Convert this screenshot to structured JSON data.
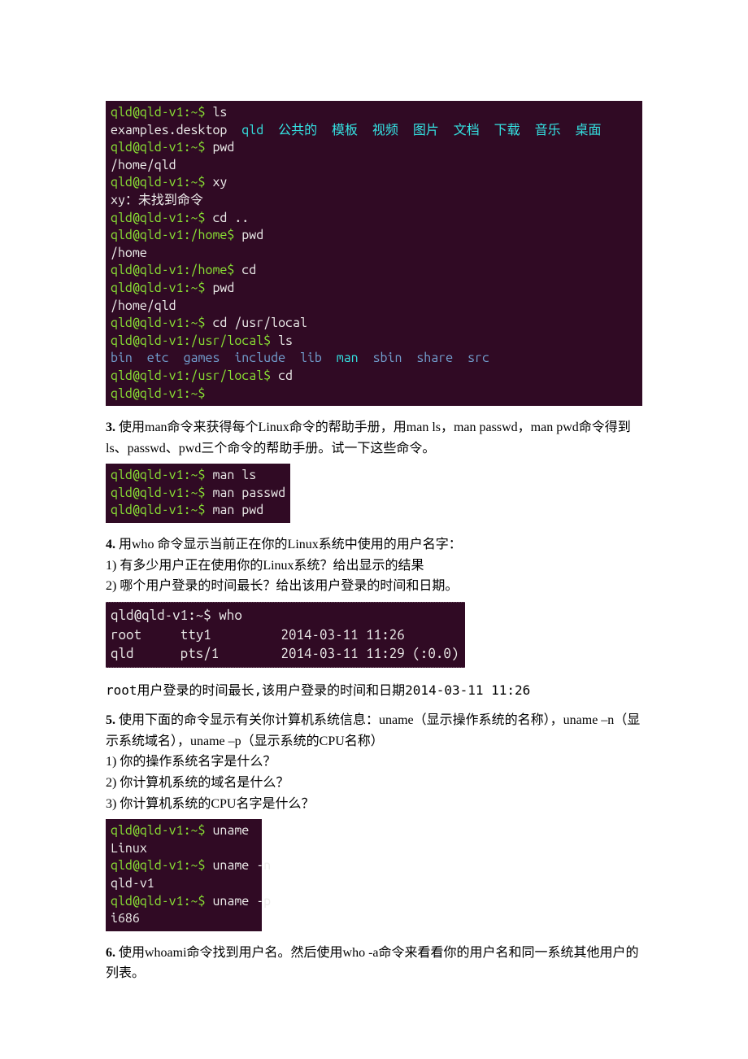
{
  "terminal1": {
    "l1_prompt": "qld@qld-v1:~$",
    "l1_cmd": " ls",
    "l2_a": "examples.desktop  ",
    "l2_b": "qld  公共的  模板  视频  图片  文档  下载  音乐  桌面",
    "l3_prompt": "qld@qld-v1:~$",
    "l3_cmd": " pwd",
    "l4": "/home/qld",
    "l5_prompt": "qld@qld-v1:~$",
    "l5_cmd": " xy",
    "l6": "xy：未找到命令",
    "l7_prompt": "qld@qld-v1:~$",
    "l7_cmd": " cd ..",
    "l8_prompt": "qld@qld-v1:/home$",
    "l8_cmd": " pwd",
    "l9": "/home",
    "l10_prompt": "qld@qld-v1:/home$",
    "l10_cmd": " cd",
    "l11_prompt": "qld@qld-v1:~$",
    "l11_cmd": " pwd",
    "l12": "/home/qld",
    "l13_prompt": "qld@qld-v1:~$",
    "l13_cmd": " cd /usr/local",
    "l14_prompt": "qld@qld-v1:/usr/local$",
    "l14_cmd": " ls",
    "l15_a": "bin  etc  games  include  lib  ",
    "l15_b": "man",
    "l15_c": "  sbin  share  ",
    "l15_d": "src",
    "l16_prompt": "qld@qld-v1:/usr/local$",
    "l16_cmd": " cd",
    "l17_prompt": "qld@qld-v1:~$",
    "l17_cmd": ""
  },
  "q3": {
    "body": "使用man命令来获得每个Linux命令的帮助手册，用man ls，man passwd，man pwd命令得到ls、passwd、pwd三个命令的帮助手册。试一下这些命令。",
    "num": "3. "
  },
  "terminal2": {
    "l1_prompt": "qld@qld-v1:~$",
    "l1_cmd": " man ls",
    "l2_prompt": "qld@qld-v1:~$",
    "l2_cmd": " man passwd",
    "l3_prompt": "qld@qld-v1:~$",
    "l3_cmd": " man pwd"
  },
  "q4": {
    "num": "4. ",
    "l1": "用who 命令显示当前正在你的Linux系统中使用的用户名字：",
    "l2": "1) 有多少用户正在使用你的Linux系统？给出显示的结果",
    "l3": "2) 哪个用户登录的时间最长？给出该用户登录的时间和日期。"
  },
  "terminal3": {
    "l1_prompt": "qld@qld-v1:~$",
    "l1_cmd": " who",
    "row1": "root     tty1         2014-03-11 11:26",
    "row2": "qld      pts/1        2014-03-11 11:29 (:0.0)"
  },
  "note4": "root用户登录的时间最长,该用户登录的时间和日期2014-03-11 11:26",
  "q5": {
    "num": "5. ",
    "l1": "使用下面的命令显示有关你计算机系统信息：uname（显示操作系统的名称），uname –n（显示系统域名），uname –p（显示系统的CPU名称）",
    "l2": "1) 你的操作系统名字是什么？",
    "l3": "2) 你计算机系统的域名是什么？",
    "l4": "3) 你计算机系统的CPU名字是什么？"
  },
  "terminal4": {
    "l1_prompt": "qld@qld-v1:~$",
    "l1_cmd": " uname",
    "l2": "Linux",
    "l3_prompt": "qld@qld-v1:~$",
    "l3_cmd": " uname -n",
    "l4": "qld-v1",
    "l5_prompt": "qld@qld-v1:~$",
    "l5_cmd": " uname -p",
    "l6": "i686"
  },
  "q6": {
    "num": "6. ",
    "body": "使用whoami命令找到用户名。然后使用who -a命令来看看你的用户名和同一系统其他用户的列表。"
  }
}
